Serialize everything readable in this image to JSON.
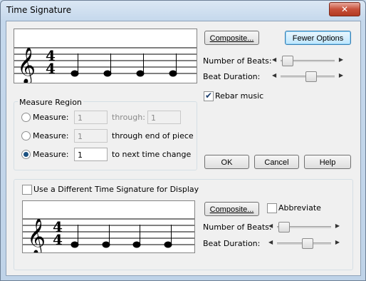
{
  "window": {
    "title": "Time Signature",
    "close_label": "✕"
  },
  "upper": {
    "composite_label": "Composite...",
    "fewer_options_label": "Fewer Options",
    "number_of_beats_label": "Number of Beats:",
    "beat_duration_label": "Beat Duration:",
    "number_of_beats_level": 0.08,
    "beat_duration_level": 0.55,
    "rebar_label": "Rebar music",
    "rebar_checked": true,
    "time_signature": {
      "top": "4",
      "bottom": "4"
    }
  },
  "measure_region": {
    "title": "Measure Region",
    "rows": [
      {
        "label": "Measure:",
        "value": "1",
        "through_label": "through:",
        "through_value": "1",
        "selected": false,
        "enabled": false
      },
      {
        "label": "Measure:",
        "value": "1",
        "through_label": "through end of piece",
        "selected": false,
        "enabled": false
      },
      {
        "label": "Measure:",
        "value": "1",
        "through_label": "to next time change",
        "selected": true,
        "enabled": true
      }
    ]
  },
  "buttons": {
    "ok": "OK",
    "cancel": "Cancel",
    "help": "Help"
  },
  "lower": {
    "use_different_label": "Use a Different Time Signature for Display",
    "use_different_checked": false,
    "composite_label": "Composite...",
    "abbreviate_label": "Abbreviate",
    "abbreviate_checked": false,
    "number_of_beats_label": "Number of Beats:",
    "beat_duration_label": "Beat Duration:",
    "number_of_beats_level": 0.08,
    "beat_duration_level": 0.55,
    "time_signature": {
      "top": "4",
      "bottom": "4"
    }
  },
  "colors": {
    "title_bg": "#c5d8ec",
    "close_red": "#c7503a",
    "dialog_bg": "#f0f0f0"
  }
}
